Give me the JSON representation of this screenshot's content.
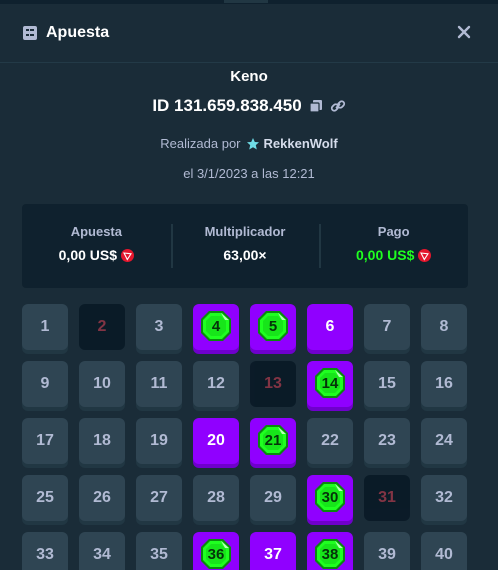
{
  "header": {
    "title": "Apuesta",
    "icon": "ticket-icon",
    "close_icon": "close-icon"
  },
  "game": {
    "name": "Keno",
    "id_text": "ID 131.659.838.450",
    "placed_by": "Realizada por",
    "username": "RekkenWolf",
    "date": "el 3/1/2023 a las 12:21"
  },
  "stats": {
    "bet_label": "Apuesta",
    "bet_value": "0,00 US$",
    "multiplier_label": "Multiplicador",
    "multiplier_value": "63,00×",
    "payout_label": "Pago",
    "payout_value": "0,00 US$"
  },
  "colors": {
    "accent": "#9000ff",
    "gem": "#1fff20",
    "miss": "#ff4a5f",
    "panel": "#0f212e",
    "background": "#1a2c38"
  },
  "grid": {
    "numbers": [
      "1",
      "2",
      "3",
      "4",
      "5",
      "6",
      "7",
      "8",
      "9",
      "10",
      "11",
      "12",
      "13",
      "14",
      "15",
      "16",
      "17",
      "18",
      "19",
      "20",
      "21",
      "22",
      "23",
      "24",
      "25",
      "26",
      "27",
      "28",
      "29",
      "30",
      "31",
      "32",
      "33",
      "34",
      "35",
      "36",
      "37",
      "38",
      "39",
      "40"
    ],
    "hits": [
      "4",
      "5",
      "14",
      "21",
      "30",
      "36",
      "38"
    ],
    "picked_no_hit": [
      "6",
      "20",
      "37"
    ],
    "drawn_misses": [
      "2",
      "13",
      "31"
    ]
  }
}
